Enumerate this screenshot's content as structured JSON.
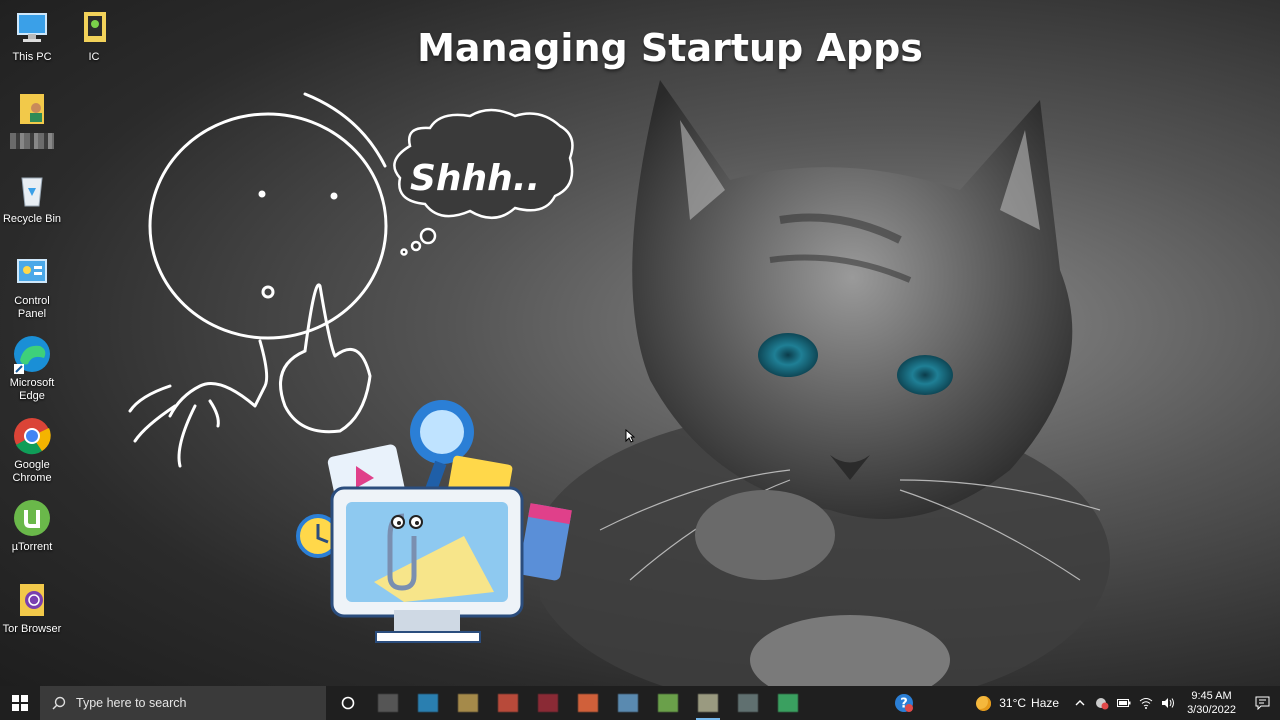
{
  "headline": "Managing Startup Apps",
  "bubble_text": "Shhh..",
  "desktop_icons": [
    {
      "label": "This PC",
      "icon": "this-pc-icon"
    },
    {
      "label": "IC",
      "icon": "folder-icon"
    },
    {
      "label": "",
      "icon": "user-folder-icon"
    },
    {
      "label": "Recycle Bin",
      "icon": "recycle-bin-icon"
    },
    {
      "label": "Control Panel",
      "icon": "control-panel-icon"
    },
    {
      "label": "Microsoft Edge",
      "icon": "edge-icon"
    },
    {
      "label": "Google Chrome",
      "icon": "chrome-icon"
    },
    {
      "label": "µTorrent",
      "icon": "utorrent-icon"
    },
    {
      "label": "Tor Browser",
      "icon": "tor-browser-icon"
    }
  ],
  "taskbar": {
    "search_placeholder": "Type here to search",
    "pinned_apps": [
      {
        "icon": "app-icon",
        "color": "#555555"
      },
      {
        "icon": "app-icon",
        "color": "#2a7fb0"
      },
      {
        "icon": "app-icon",
        "color": "#a58a4a"
      },
      {
        "icon": "app-icon",
        "color": "#b84a3a"
      },
      {
        "icon": "app-icon",
        "color": "#8a2a35"
      },
      {
        "icon": "app-icon",
        "color": "#d0603a"
      },
      {
        "icon": "app-icon",
        "color": "#5a8ab0"
      },
      {
        "icon": "app-icon",
        "color": "#6aa04a"
      },
      {
        "icon": "app-icon",
        "color": "#9a9a80"
      },
      {
        "icon": "app-icon",
        "color": "#607070"
      },
      {
        "icon": "app-icon",
        "color": "#3aa060"
      }
    ],
    "help_icon": "help-icon",
    "weather": {
      "temp": "31°C",
      "condition": "Haze"
    },
    "clock": {
      "time": "9:45 AM",
      "date": "3/30/2022"
    }
  }
}
